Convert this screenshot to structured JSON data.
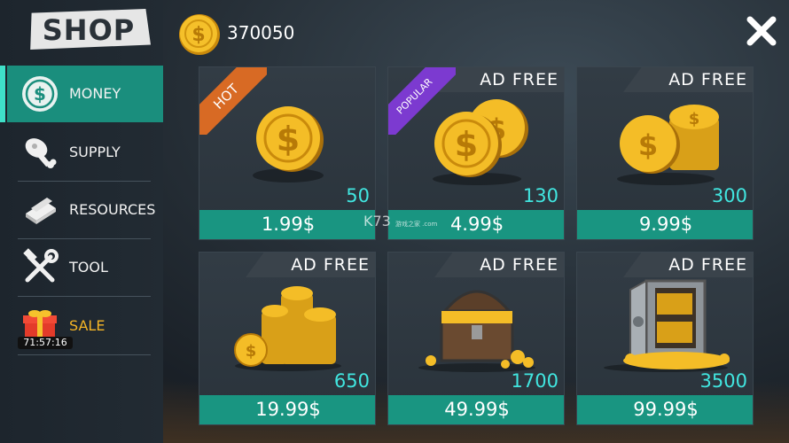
{
  "sidebar": {
    "title": "SHOP",
    "items": [
      {
        "label": "MONEY",
        "icon": "coin-icon"
      },
      {
        "label": "SUPPLY",
        "icon": "meat-icon"
      },
      {
        "label": "RESOURCES",
        "icon": "planks-icon"
      },
      {
        "label": "TOOL",
        "icon": "wrench-hammer-icon"
      },
      {
        "label": "SALE",
        "icon": "gift-box-icon",
        "timer": "71:57:16"
      }
    ]
  },
  "header": {
    "balance": "370050",
    "balance_icon": "coin-icon",
    "close_icon": "close-icon"
  },
  "cards": [
    {
      "ribbon": "HOT",
      "amount": "50",
      "price": "1.99$",
      "art": "single-coin"
    },
    {
      "ribbon": "POPULAR",
      "badge": "AD  FREE",
      "amount": "130",
      "price": "4.99$",
      "art": "two-coins"
    },
    {
      "badge": "AD  FREE",
      "amount": "300",
      "price": "9.99$",
      "art": "coin-stacks"
    },
    {
      "badge": "AD  FREE",
      "amount": "650",
      "price": "19.99$",
      "art": "coin-pile"
    },
    {
      "badge": "AD  FREE",
      "amount": "1700",
      "price": "49.99$",
      "art": "treasure-chest"
    },
    {
      "badge": "AD  FREE",
      "amount": "3500",
      "price": "99.99$",
      "art": "safe-with-gold"
    }
  ],
  "watermark": {
    "main": "K73",
    "sub": "游戏之家 .com"
  },
  "colors": {
    "accent": "#1a8e7d",
    "price_bar": "#199581",
    "amount_text": "#41e6e0",
    "hot_ribbon": "#d86a24",
    "popular_ribbon": "#7c3ad0",
    "sale_text": "#f5b526"
  }
}
